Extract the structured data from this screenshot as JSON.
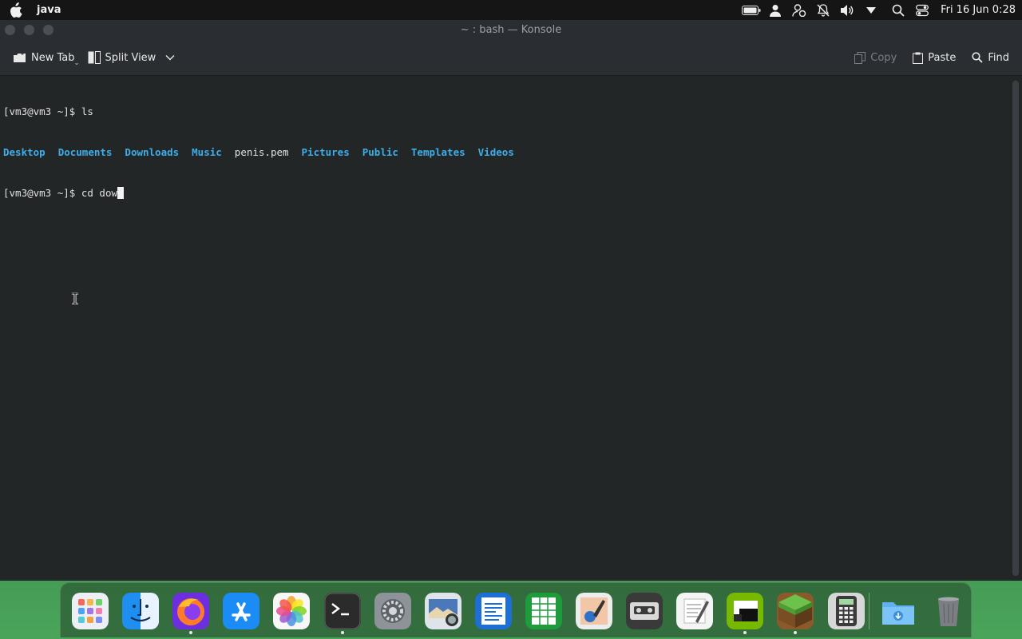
{
  "menubar": {
    "app_name": "java",
    "clock": "Fri 16 Jun 0:28",
    "icons": [
      "apple-icon",
      "battery-icon",
      "user-icon",
      "user-status-icon",
      "notifications-muted-icon",
      "volume-icon",
      "dropdown-icon",
      "search-icon",
      "control-center-icon"
    ]
  },
  "window": {
    "title": "~ : bash — Konsole"
  },
  "toolbar": {
    "new_tab": "New Tab",
    "split_view": "Split View",
    "copy": "Copy",
    "paste": "Paste",
    "find": "Find"
  },
  "terminal": {
    "line1_prompt": "[vm3@vm3 ~]$ ",
    "line1_cmd": "ls",
    "ls_entries": [
      {
        "name": "Desktop",
        "type": "dir"
      },
      {
        "name": "Documents",
        "type": "dir"
      },
      {
        "name": "Downloads",
        "type": "dir"
      },
      {
        "name": "Music",
        "type": "dir"
      },
      {
        "name": "penis.pem",
        "type": "file"
      },
      {
        "name": "Pictures",
        "type": "dir"
      },
      {
        "name": "Public",
        "type": "dir"
      },
      {
        "name": "Templates",
        "type": "dir"
      },
      {
        "name": "Videos",
        "type": "dir"
      }
    ],
    "line3_prompt": "[vm3@vm3 ~]$ ",
    "line3_cmd": "cd dow"
  },
  "colors": {
    "dir_color": "#3daee9",
    "terminal_bg": "#232627",
    "menubar_bg": "#151515"
  },
  "dock": {
    "apps": [
      {
        "name": "launchpad-icon",
        "running": false
      },
      {
        "name": "finder-icon",
        "running": false
      },
      {
        "name": "firefox-icon",
        "running": true
      },
      {
        "name": "app-store-icon",
        "running": false
      },
      {
        "name": "photos-icon",
        "running": false
      },
      {
        "name": "terminal-icon",
        "running": true
      },
      {
        "name": "system-settings-icon",
        "running": false
      },
      {
        "name": "image-viewer-icon",
        "running": false
      },
      {
        "name": "writer-icon",
        "running": false
      },
      {
        "name": "spreadsheet-icon",
        "running": false
      },
      {
        "name": "paint-icon",
        "running": false
      },
      {
        "name": "cassette-player-icon",
        "running": false
      },
      {
        "name": "text-editor-icon",
        "running": false
      },
      {
        "name": "nvidia-icon",
        "running": true
      },
      {
        "name": "minecraft-icon",
        "running": true
      },
      {
        "name": "calculator-icon",
        "running": false
      },
      {
        "name": "downloads-folder-icon",
        "running": false
      },
      {
        "name": "trash-icon",
        "running": false
      }
    ]
  }
}
